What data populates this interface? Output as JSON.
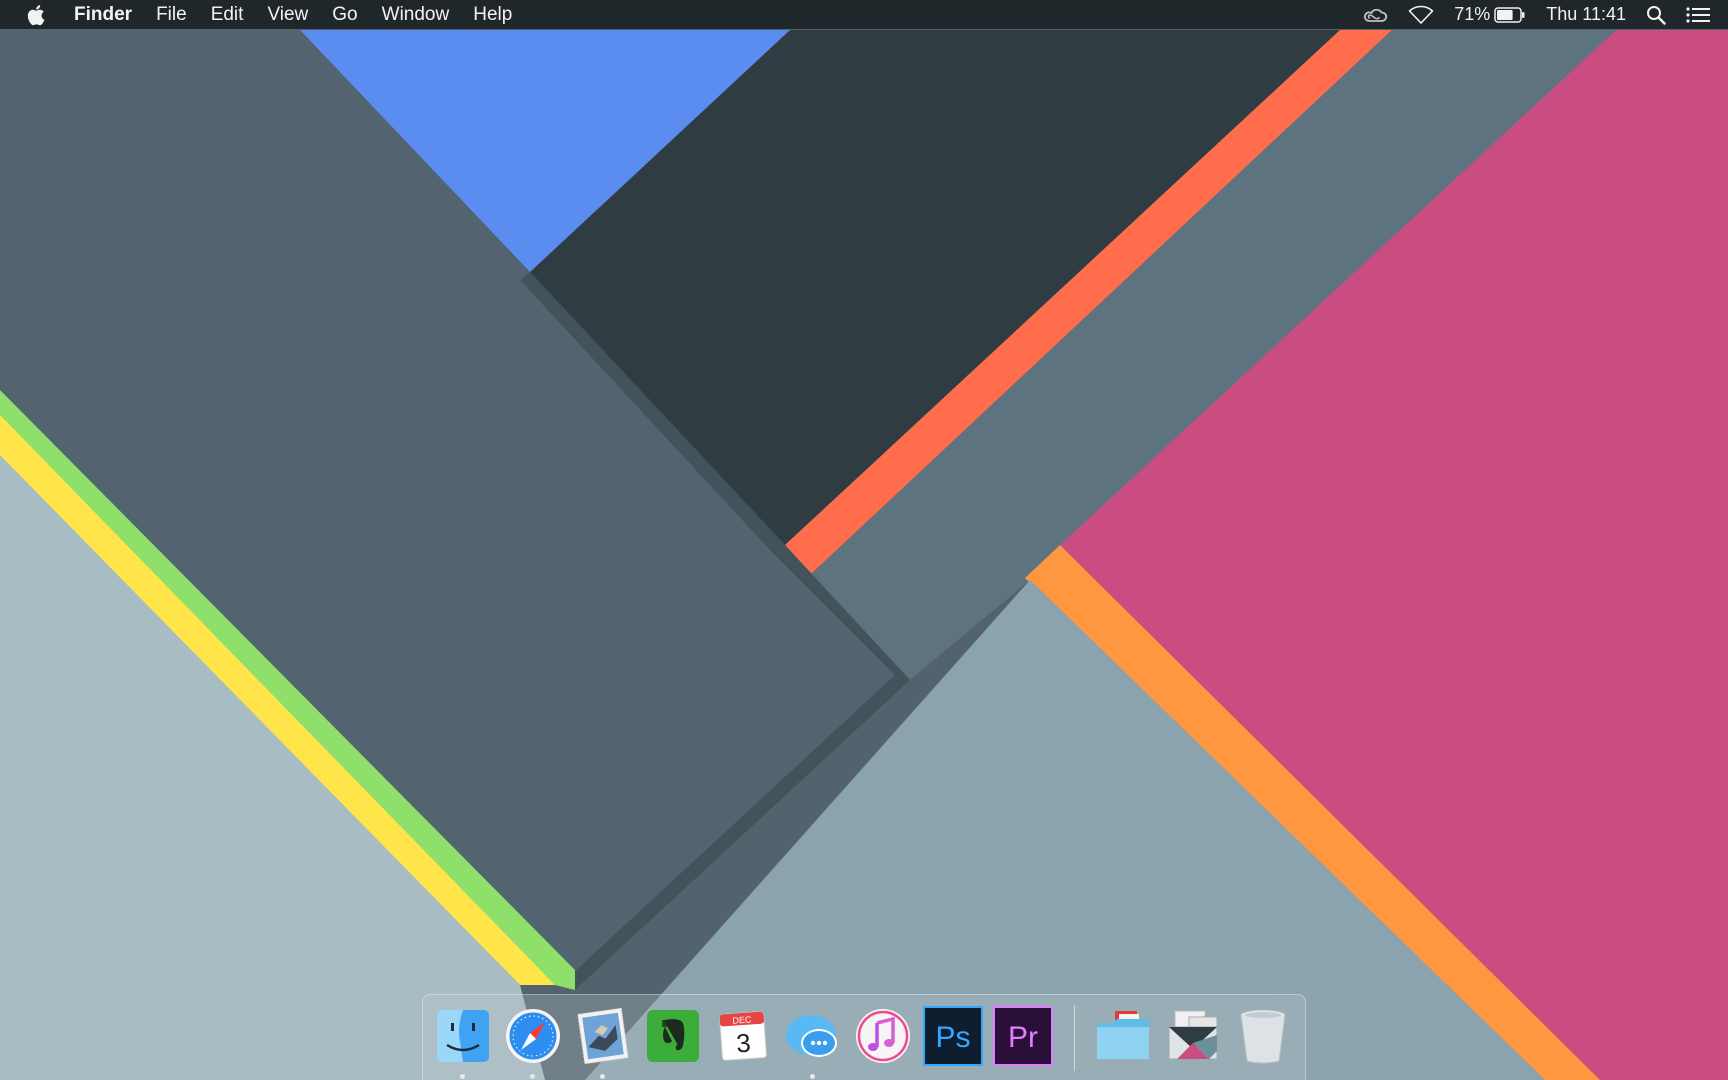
{
  "menubar": {
    "apple_icon": "apple-logo-icon",
    "app_name": "Finder",
    "menus": [
      "File",
      "Edit",
      "View",
      "Go",
      "Window",
      "Help"
    ],
    "status": {
      "creative_cloud_icon": "creative-cloud-icon",
      "wifi_icon": "wifi-icon",
      "battery_percent": "71%",
      "battery_level": 0.71,
      "clock": "Thu 11:41",
      "spotlight_icon": "magnifier-icon",
      "notification_icon": "list-icon"
    }
  },
  "dock": {
    "apps": [
      {
        "name": "Finder",
        "icon": "finder-icon",
        "running": true
      },
      {
        "name": "Safari",
        "icon": "safari-compass-icon",
        "running": true
      },
      {
        "name": "Mail",
        "icon": "mail-stamp-icon",
        "running": true
      },
      {
        "name": "Evernote",
        "icon": "evernote-elephant-icon",
        "running": false
      },
      {
        "name": "Calendar",
        "icon": "calendar-icon",
        "running": false,
        "month": "DEC",
        "day": "3"
      },
      {
        "name": "Messages",
        "icon": "messages-bubble-icon",
        "running": true
      },
      {
        "name": "iTunes",
        "icon": "music-note-icon",
        "running": false
      },
      {
        "name": "Photoshop",
        "icon": "photoshop-icon",
        "running": false,
        "label": "Ps"
      },
      {
        "name": "Premiere Pro",
        "icon": "premiere-icon",
        "running": false,
        "label": "Pr"
      }
    ],
    "others": [
      {
        "name": "Documents",
        "icon": "folder-icon"
      },
      {
        "name": "Downloads",
        "icon": "stack-icon"
      },
      {
        "name": "Trash",
        "icon": "trash-icon"
      }
    ]
  },
  "colors": {
    "blue": "#5b8cf0",
    "red_stripe": "#ff6d4d",
    "orange_stripe": "#ff9640",
    "pink": "#c94d80",
    "green": "#8ee06b",
    "yellow": "#ffe54a"
  }
}
